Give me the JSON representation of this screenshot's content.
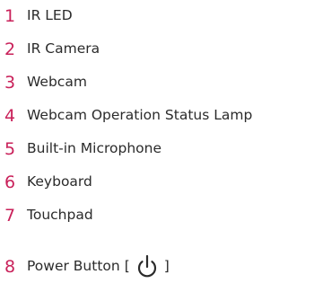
{
  "colors": {
    "number": "#c9215a",
    "text": "#2b2b2b"
  },
  "items": [
    {
      "number": "1",
      "label": "IR LED"
    },
    {
      "number": "2",
      "label": "IR Camera"
    },
    {
      "number": "3",
      "label": "Webcam"
    },
    {
      "number": "4",
      "label": "Webcam Operation Status Lamp"
    },
    {
      "number": "5",
      "label": "Built-in Microphone"
    },
    {
      "number": "6",
      "label": "Keyboard"
    },
    {
      "number": "7",
      "label": "Touchpad"
    },
    {
      "number": "8",
      "label": "Power Button",
      "bracket_open": "[",
      "bracket_close": "]",
      "icon": "power-icon"
    }
  ]
}
